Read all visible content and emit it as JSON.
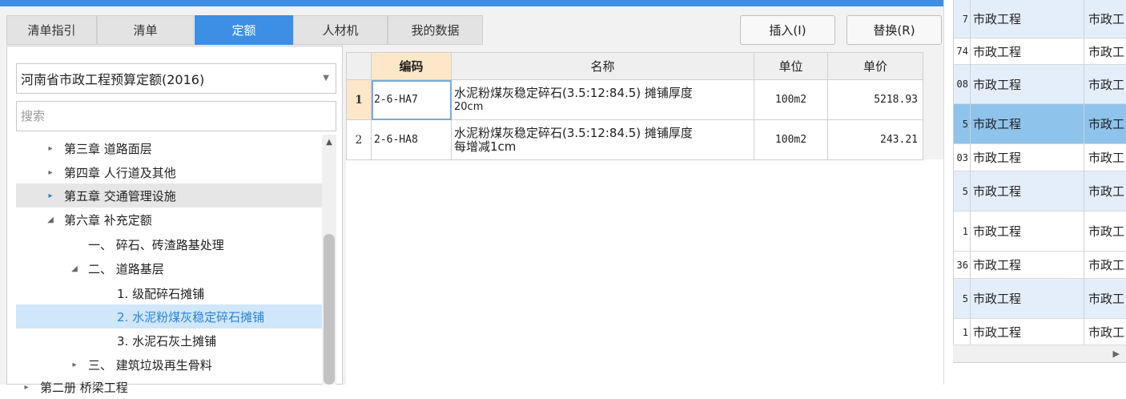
{
  "tabs": [
    "清单指引",
    "清单",
    "定额",
    "人材机",
    "我的数据"
  ],
  "active_tab": "定额",
  "buttons": {
    "insert": "插入(I)",
    "replace": "替换(R)"
  },
  "quota_selector": {
    "value": "河南省市政工程预算定额(2016)"
  },
  "search": {
    "placeholder": "搜索"
  },
  "tree": [
    {
      "label": "第三章 道路面层",
      "toggle": "▸"
    },
    {
      "label": "第四章 人行道及其他",
      "toggle": "▸"
    },
    {
      "label": "第五章 交通管理设施",
      "toggle": "▸"
    },
    {
      "label": "第六章 补充定额",
      "toggle": "◢"
    },
    {
      "label": "一、 碎石、砖渣路基处理",
      "toggle": ""
    },
    {
      "label": "二、 道路基层",
      "toggle": "◢"
    },
    {
      "label": "1. 级配碎石摊铺",
      "toggle": ""
    },
    {
      "label": "2. 水泥粉煤灰稳定碎石摊铺",
      "toggle": ""
    },
    {
      "label": "3. 水泥石灰土摊铺",
      "toggle": ""
    },
    {
      "label": "三、 建筑垃圾再生骨料",
      "toggle": "▸"
    },
    {
      "label": "第二册 桥梁工程",
      "toggle": "▸"
    }
  ],
  "grid": {
    "headers": {
      "code": "编码",
      "name": "名称",
      "unit": "单位",
      "price": "单价"
    },
    "rows": [
      {
        "num": "1",
        "code": "2-6-HA7",
        "name1": "水泥粉煤灰稳定碎石(3.5:12:84.5) 摊铺厚度",
        "name2": "20cm",
        "unit": "100m2",
        "price": "5218.93"
      },
      {
        "num": "2",
        "code": "2-6-HA8",
        "name1": "水泥粉煤灰稳定碎石(3.5:12:84.5) 摊铺厚度",
        "name2": "每增减1cm",
        "unit": "100m2",
        "price": "243.21"
      }
    ]
  },
  "right_list": [
    {
      "n": "7",
      "a": "市政工程",
      "b": "市政工"
    },
    {
      "n": "74",
      "a": "市政工程",
      "b": "市政工"
    },
    {
      "n": "08",
      "a": "市政工程",
      "b": "市政工"
    },
    {
      "n": "5",
      "a": "市政工程",
      "b": "市政工"
    },
    {
      "n": "03",
      "a": "市政工程",
      "b": "市政工"
    },
    {
      "n": "5",
      "a": "市政工程",
      "b": "市政工"
    },
    {
      "n": "1",
      "a": "市政工程",
      "b": "市政工"
    },
    {
      "n": "36",
      "a": "市政工程",
      "b": "市政工"
    },
    {
      "n": "5",
      "a": "市政工程",
      "b": "市政工"
    },
    {
      "n": "1",
      "a": "市政工程",
      "b": "市政工"
    }
  ],
  "icons": {
    "dropdown": "chevron-down-icon",
    "scroll_right": "scroll-right-arrow-icon"
  }
}
